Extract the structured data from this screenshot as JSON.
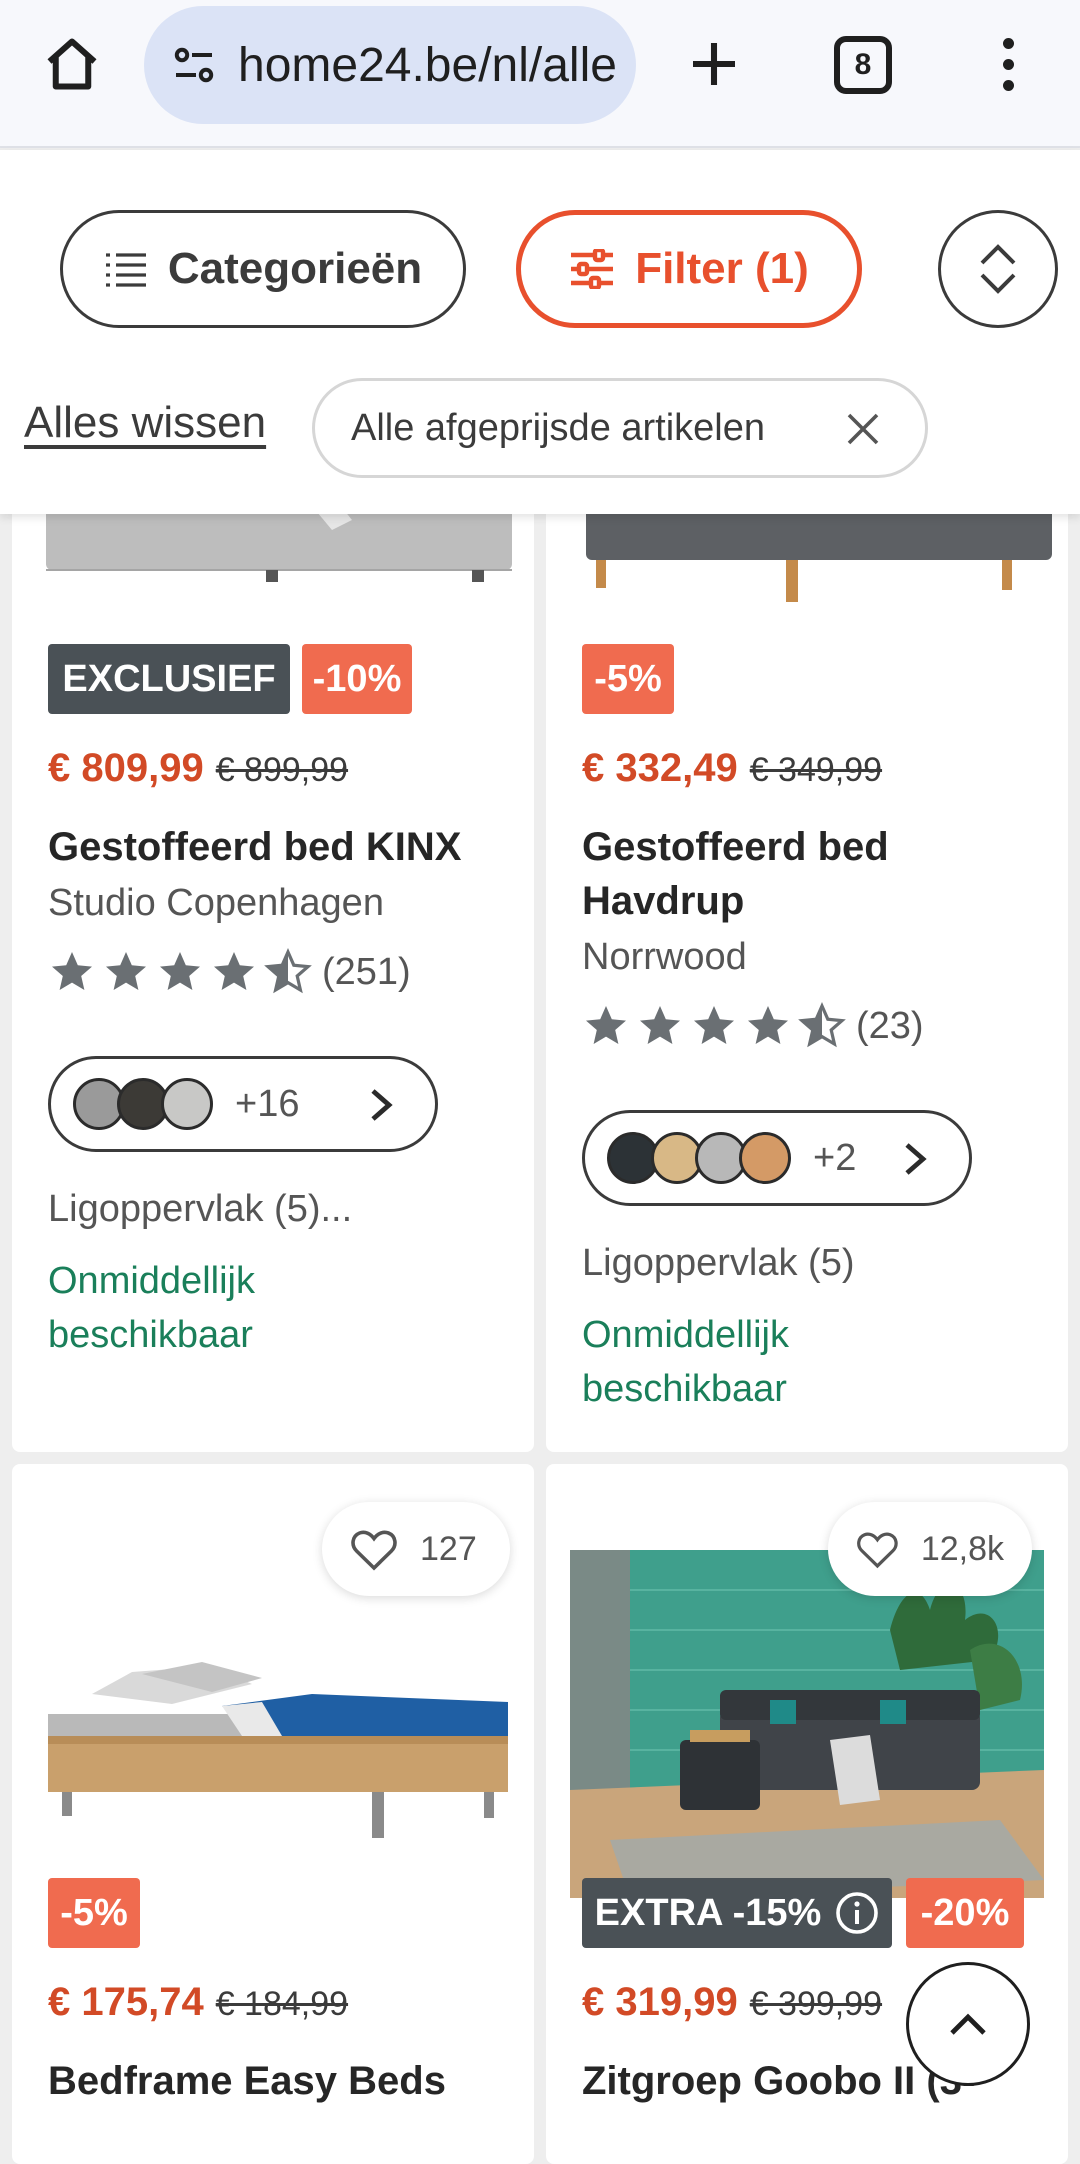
{
  "browser": {
    "url": "home24.be/nl/alle",
    "tab_count": "8"
  },
  "filters": {
    "categories_label": "Categorieën",
    "filter_label": "Filter (1)",
    "clear_all": "Alles wissen",
    "active_chip": "Alle afgeprijsde artikelen"
  },
  "products": [
    {
      "badges": [
        "EXCLUSIEF",
        "-10%"
      ],
      "price": "€ 809,99",
      "old_price": "€ 899,99",
      "title": "Gestoffeerd bed KINX",
      "brand": "Studio Copenhagen",
      "rating": 4.5,
      "reviews": "(251)",
      "swatch_colors": [
        "#9a9a9a",
        "#3c3a36",
        "#c8c8c6"
      ],
      "more_colors": "+16",
      "feature": "Ligoppervlak (5)...",
      "stock": "Onmiddellijk beschikbaar"
    },
    {
      "badges": [
        "-5%"
      ],
      "price": "€ 332,49",
      "old_price": "€ 349,99",
      "title": "Gestoffeerd bed Havdrup",
      "brand": "Norrwood",
      "rating": 4.5,
      "reviews": "(23)",
      "swatch_colors": [
        "#2c3236",
        "#d8b886",
        "#b8b8b8",
        "#d49a66"
      ],
      "more_colors": "+2",
      "feature": "Ligoppervlak (5)",
      "stock": "Onmiddellijk beschikbaar"
    },
    {
      "badges": [
        "-5%"
      ],
      "price": "€ 175,74",
      "old_price": "€ 184,99",
      "title": "Bedframe Easy Beds",
      "favorites": "127"
    },
    {
      "badges": [
        "EXTRA -15%",
        "-20%"
      ],
      "price": "€ 319,99",
      "old_price": "€ 399,99",
      "title": "Zitgroep Goobo II (3-",
      "favorites": "12,8k"
    }
  ],
  "colors": {
    "accent": "#e8502d",
    "sale_badge": "#f06b4f",
    "exclusive_badge": "#4a5156",
    "stock_green": "#1a7f5a"
  }
}
